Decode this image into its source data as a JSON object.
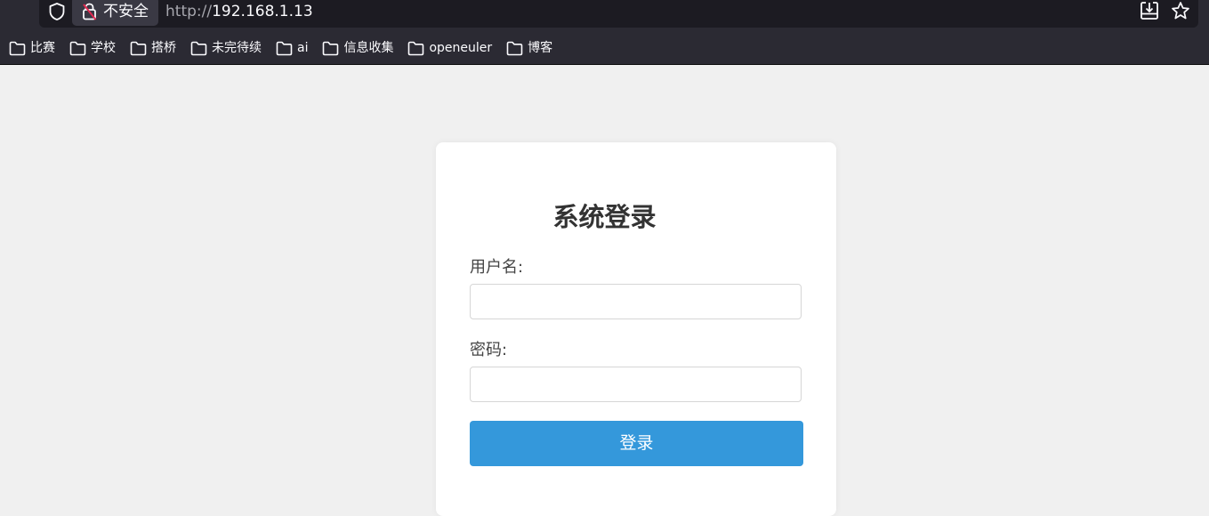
{
  "browser": {
    "security_badge": "不安全",
    "url_protocol": "http://",
    "url_host": "192.168.1.13",
    "bookmarks": [
      "比赛",
      "学校",
      "搭桥",
      "未完待续",
      "ai",
      "信息收集",
      "openeuler",
      "博客"
    ]
  },
  "login": {
    "title": "系统登录",
    "username_label": "用户名:",
    "username_value": "",
    "password_label": "密码:",
    "password_value": "",
    "submit_label": "登录"
  },
  "colors": {
    "accent": "#3498db",
    "page_background": "#f0f0f0",
    "chrome_background": "#2b2a33"
  }
}
